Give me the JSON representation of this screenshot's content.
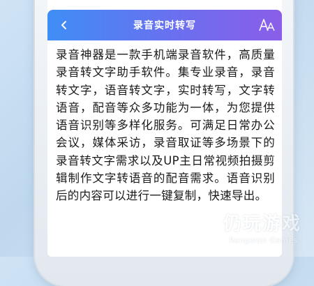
{
  "header": {
    "title": "录音实时转写",
    "back_icon": "chevron-left-icon",
    "font_size_icon": "font-size-icon"
  },
  "content": {
    "paragraph": "录音神器是一款手机端录音软件，高质量录音转文字助手软件。集专业录音，录音转文字，语音转文字，实时转写，文字转语音，配音等众多功能为一体，为您提供语音识别等多样化服务。可满足日常办公会议，媒体采访，录音取证等多场景下的录音转文字需求以及UP主日常视频拍摄剪辑制作文字转语音的配音需求。语音识别后的内容可以进行一键复制，快速导出。"
  },
  "watermark": {
    "name_cn": "仍玩游戏",
    "name_en": "Rengwan Games"
  },
  "colors": {
    "header_start": "#3f8ef5",
    "header_end": "#8a5ee8",
    "text": "#1a1a1a",
    "background": "#cfe3f5"
  }
}
